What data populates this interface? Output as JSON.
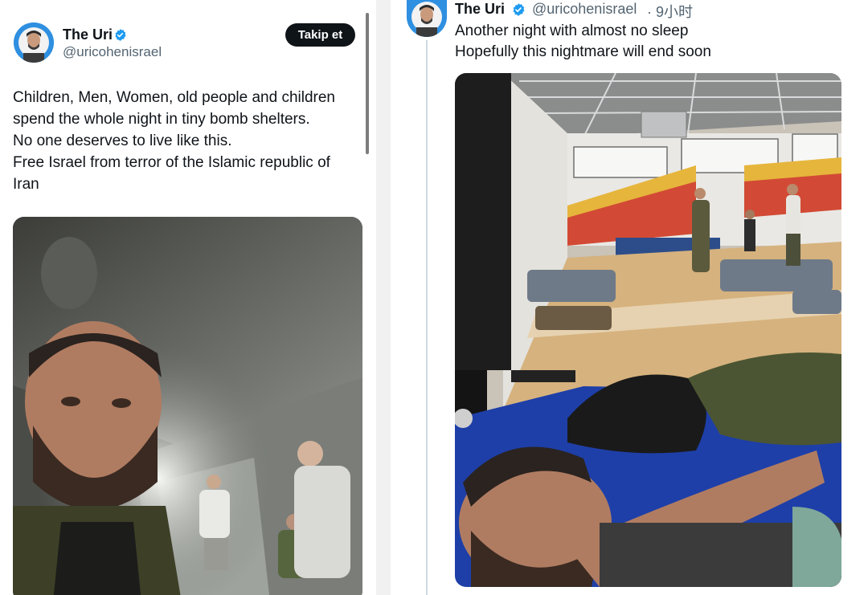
{
  "left_tweet": {
    "author_name": "The Uri",
    "handle": "@uricohenisrael",
    "follow_label": "Takip et",
    "lines": [
      "Children, Men, Women, old people and children",
      "spend the whole night in tiny bomb shelters.",
      "No one deserves to live like this.",
      "Free Israel from terror of the Islamic republic of",
      "Iran"
    ]
  },
  "right_tweet": {
    "author_name": "The Uri",
    "handle": "@uricohenisrael",
    "time": "· 9小时",
    "lines": [
      "Another night with almost no sleep",
      "Hopefully this nightmare will end soon"
    ]
  },
  "colors": {
    "verified": "#1d9bf0",
    "text_primary": "#0f1419",
    "text_secondary": "#536471",
    "follow_button": "#0f1419"
  },
  "icons": [
    "verified-badge-icon",
    "avatar"
  ]
}
